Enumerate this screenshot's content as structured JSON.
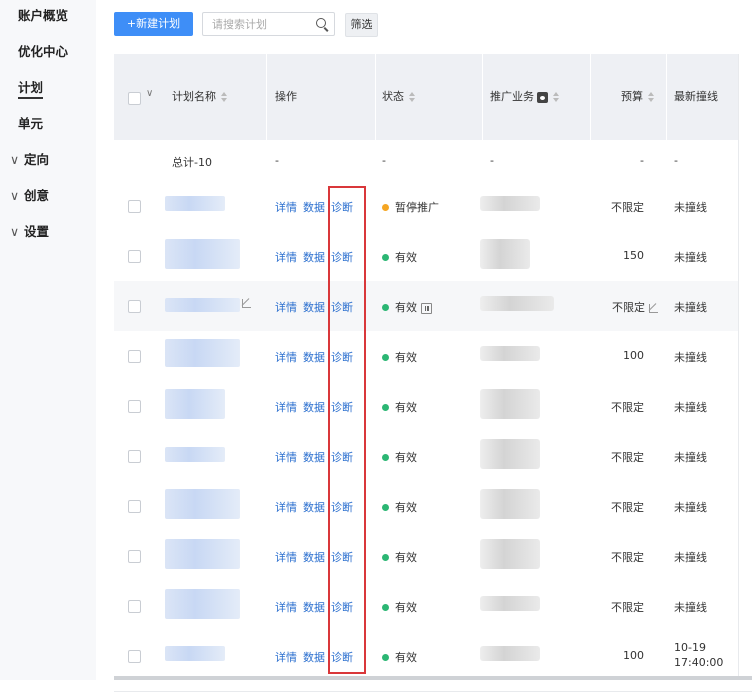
{
  "sidebar": {
    "items": [
      {
        "label": "账户概览",
        "active": false,
        "expandable": false
      },
      {
        "label": "优化中心",
        "active": false,
        "expandable": false
      },
      {
        "label": "计划",
        "active": true,
        "expandable": false
      },
      {
        "label": "单元",
        "active": false,
        "expandable": false
      },
      {
        "label": "定向",
        "active": false,
        "expandable": true
      },
      {
        "label": "创意",
        "active": false,
        "expandable": true
      },
      {
        "label": "设置",
        "active": false,
        "expandable": true
      }
    ]
  },
  "toolbar": {
    "new_plan_label": "+新建计划",
    "search_placeholder": "请搜索计划",
    "filter_label": "筛选"
  },
  "table": {
    "headers": {
      "name": "计划名称",
      "actions": "操作",
      "status": "状态",
      "business": "推广业务",
      "budget": "预算",
      "latest": "最新撞线"
    },
    "total": {
      "name": "总计-10",
      "actions": "-",
      "status": "-",
      "business": "-",
      "budget": "-",
      "latest": "-"
    },
    "action_labels": {
      "detail": "详情",
      "data": "数据",
      "diagnose": "诊断"
    },
    "rows": [
      {
        "status": "暂停推广",
        "status_color": "#f5a623",
        "budget": "不限定",
        "latest": "未撞线"
      },
      {
        "status": "有效",
        "status_color": "#2bb673",
        "budget": "150",
        "latest": "未撞线"
      },
      {
        "status": "有效",
        "status_color": "#2bb673",
        "budget": "不限定",
        "latest": "未撞线"
      },
      {
        "status": "有效",
        "status_color": "#2bb673",
        "budget": "100",
        "latest": "未撞线"
      },
      {
        "status": "有效",
        "status_color": "#2bb673",
        "budget": "不限定",
        "latest": "未撞线"
      },
      {
        "status": "有效",
        "status_color": "#2bb673",
        "budget": "不限定",
        "latest": "未撞线"
      },
      {
        "status": "有效",
        "status_color": "#2bb673",
        "budget": "不限定",
        "latest": "未撞线"
      },
      {
        "status": "有效",
        "status_color": "#2bb673",
        "budget": "不限定",
        "latest": "未撞线"
      },
      {
        "status": "有效",
        "status_color": "#2bb673",
        "budget": "不限定",
        "latest": "未撞线"
      },
      {
        "status": "有效",
        "status_color": "#2bb673",
        "budget": "100",
        "latest_line1": "10-19",
        "latest_line2": "17:40:00"
      }
    ]
  },
  "colors": {
    "primary": "#3e8ef7",
    "link": "#2b6fcf",
    "highlight_box": "#d9373a",
    "active_status": "#2bb673",
    "paused_status": "#f5a623"
  }
}
